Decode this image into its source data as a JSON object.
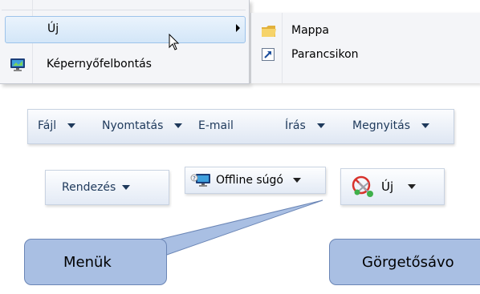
{
  "context_menu": {
    "items": [
      {
        "label": "Új",
        "icon": "none",
        "has_submenu": true,
        "highlighted": true
      },
      {
        "label": "Képernyőfelbontás",
        "icon": "monitor-icon",
        "has_submenu": false,
        "highlighted": false
      }
    ]
  },
  "submenu": {
    "items": [
      {
        "label": "Mappa",
        "icon": "folder-icon"
      },
      {
        "label": "Parancsikon",
        "icon": "shortcut-icon"
      }
    ]
  },
  "toolbar": {
    "items": [
      {
        "label": "Fájl",
        "has_dropdown": true
      },
      {
        "label": "Nyomtatás",
        "has_dropdown": true
      },
      {
        "label": "E-mail",
        "has_dropdown": false
      },
      {
        "label": "Írás",
        "has_dropdown": true
      },
      {
        "label": "Megnyitás",
        "has_dropdown": true
      }
    ]
  },
  "buttons": {
    "rendezes": {
      "label": "Rendezés"
    },
    "offline_help": {
      "label": "Offline súgó",
      "icon": "help-monitor-icon"
    },
    "uj": {
      "label": "Új",
      "icon": "scissors-icon"
    }
  },
  "callouts": {
    "menuk": "Menük",
    "gorgetosav": "Görgetősávo"
  },
  "colors": {
    "menu_text": "#1e395b",
    "highlight_border": "#9dc3ea",
    "callout_fill": "#a9bfe3",
    "callout_border": "#6b86b6"
  }
}
